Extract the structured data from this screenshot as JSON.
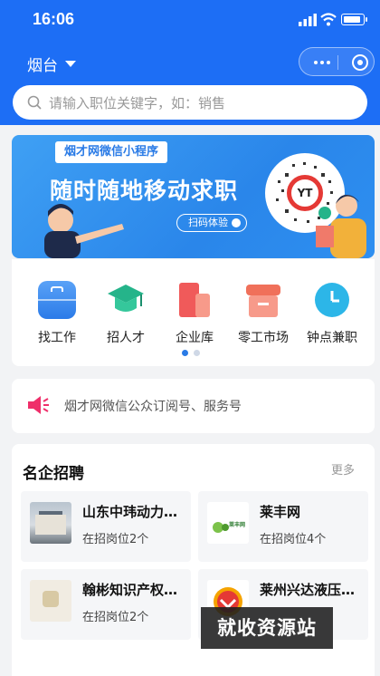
{
  "status_bar": {
    "time": "16:06"
  },
  "header": {
    "city": "烟台"
  },
  "search": {
    "placeholder": "请输入职位关键字，如：销售"
  },
  "banner": {
    "tag": "烟才网微信小程序",
    "slogan": "随时随地移动求职",
    "scan_button": "扫码体验",
    "qr_logo": "YT"
  },
  "categories": [
    {
      "label": "找工作",
      "color": "#2b7be8"
    },
    {
      "label": "招人才",
      "color": "#25b48a"
    },
    {
      "label": "企业库",
      "color": "#f05a5a"
    },
    {
      "label": "零工市场",
      "color": "#f0705a"
    },
    {
      "label": "钟点兼职",
      "color": "#2cb6e8"
    }
  ],
  "notice": {
    "text": "烟才网微信公众订阅号、服务号"
  },
  "famous": {
    "title": "名企招聘",
    "more": "更多",
    "companies": [
      {
        "name": "山东中玮动力…",
        "positions": "在招岗位2个"
      },
      {
        "name": "莱丰网",
        "positions": "在招岗位4个",
        "logo_text": "莱丰网"
      },
      {
        "name": "翰彬知识产权…",
        "positions": "在招岗位2个"
      },
      {
        "name": "莱州兴达液压…",
        "positions": ""
      }
    ]
  },
  "watermark": "就收资源站"
}
